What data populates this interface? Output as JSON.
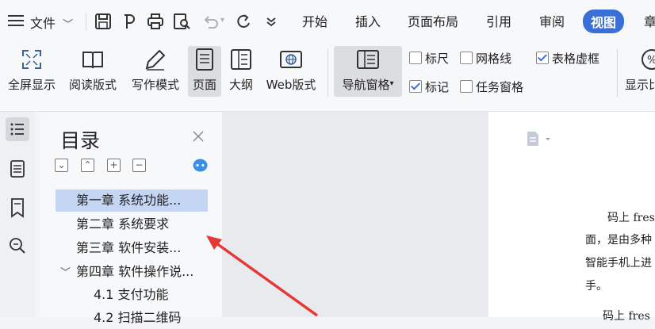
{
  "menubar": {
    "hamburger_icon": "menu-icon",
    "file_label": "文件",
    "tabs": [
      {
        "label": "开始",
        "active": false
      },
      {
        "label": "插入",
        "active": false
      },
      {
        "label": "页面布局",
        "active": false
      },
      {
        "label": "引用",
        "active": false
      },
      {
        "label": "审阅",
        "active": false
      },
      {
        "label": "视图",
        "active": true
      },
      {
        "label": "章",
        "active": false
      }
    ],
    "accent_color": "#3b6fd8"
  },
  "ribbon": {
    "buttons": [
      {
        "label": "全屏显示",
        "icon": "fullscreen-icon"
      },
      {
        "label": "阅读版式",
        "icon": "book-icon"
      },
      {
        "label": "写作模式",
        "icon": "pen-icon"
      },
      {
        "label": "页面",
        "icon": "page-icon",
        "selected": true
      },
      {
        "label": "大纲",
        "icon": "outline-icon"
      },
      {
        "label": "Web版式",
        "icon": "web-icon"
      },
      {
        "label": "导航窗格",
        "icon": "nav-pane-icon",
        "selected": true,
        "dropdown": true
      },
      {
        "label": "显示比",
        "icon": "zoom-percent-icon"
      }
    ],
    "checkboxes": [
      {
        "label": "标尺",
        "checked": false
      },
      {
        "label": "网格线",
        "checked": false
      },
      {
        "label": "表格虚框",
        "checked": true
      },
      {
        "label": "标记",
        "checked": true
      },
      {
        "label": "任务窗格",
        "checked": false
      }
    ]
  },
  "navpane": {
    "title": "目录",
    "toc": [
      {
        "label": "第一章  系统功能...",
        "level": 1,
        "active": true,
        "expander": ""
      },
      {
        "label": "第二章  系统要求",
        "level": 1,
        "active": false,
        "expander": ""
      },
      {
        "label": "第三章  软件安装...",
        "level": 1,
        "active": false,
        "expander": ""
      },
      {
        "label": "第四章  软件操作说...",
        "level": 1,
        "active": false,
        "expander": "﹀"
      },
      {
        "label": "4.1  支付功能",
        "level": 2,
        "active": false,
        "expander": ""
      },
      {
        "label": "4.2  扫描二维码",
        "level": 2,
        "active": false,
        "expander": ""
      }
    ]
  },
  "document": {
    "lines": [
      "码上 fres",
      "面，是由多种",
      "智能手机上进",
      "手。",
      "码上 fres"
    ]
  }
}
